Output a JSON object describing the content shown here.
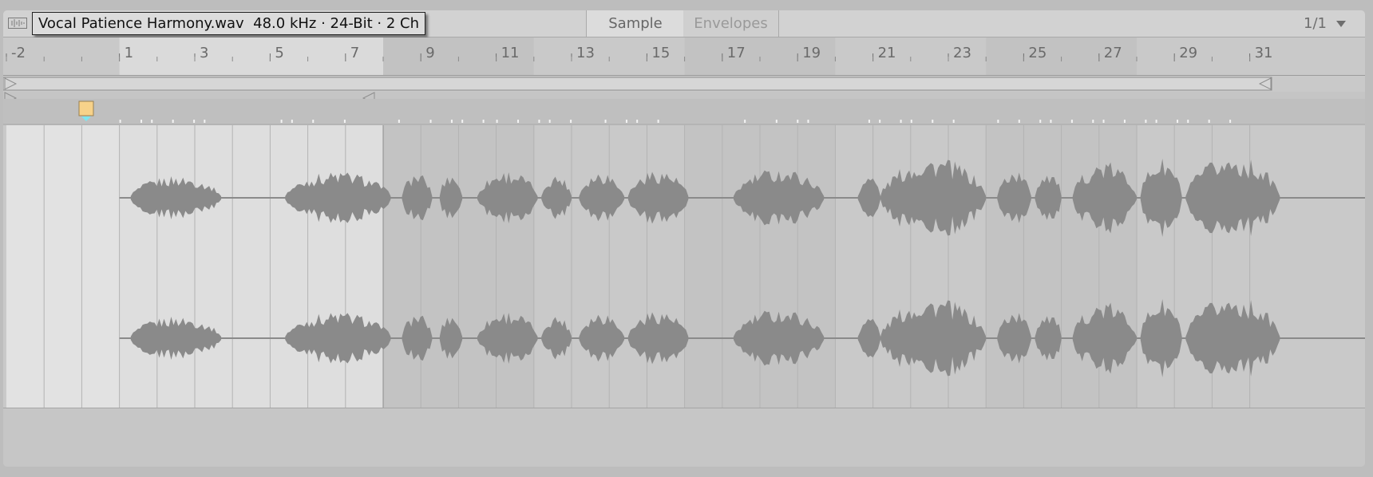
{
  "header": {
    "title": "Vocal Patience Harmony.wav  48.0 kHz · 24-Bit · 2 Ch",
    "tabs": [
      {
        "label": "Sample",
        "active": true
      },
      {
        "label": "Envelopes",
        "active": false
      }
    ],
    "page_indicator": "1/1"
  },
  "ruler": {
    "bar_labels": [
      "-2",
      "1",
      "3",
      "5",
      "7",
      "9",
      "11",
      "13",
      "15",
      "17",
      "19",
      "21",
      "23",
      "25",
      "27",
      "29",
      "31"
    ]
  },
  "colors": {
    "panel_bg": "#c9c9c9",
    "waveform": "#8a8a8a",
    "loop_region": "#dedede",
    "start_marker": "#f7d28a",
    "marker_triangle": "#7ee6f0"
  },
  "icons": {
    "clip_type": "waveform-icon",
    "page_menu": "chevron-down-icon"
  }
}
